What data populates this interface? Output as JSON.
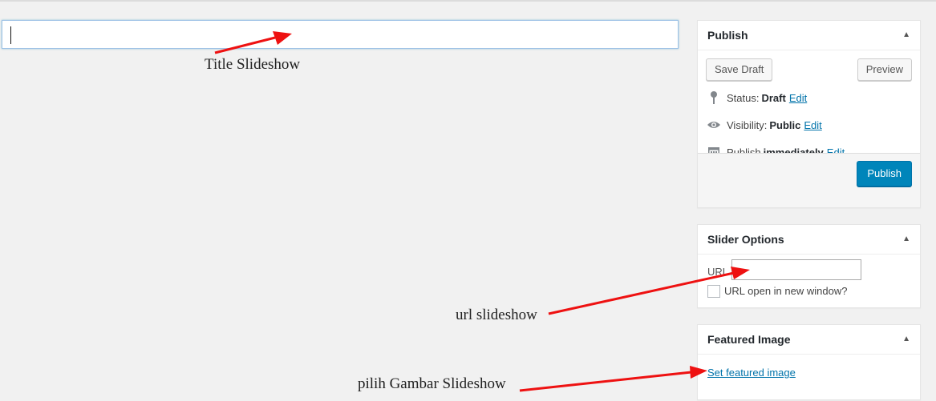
{
  "editor": {
    "title_value": ""
  },
  "annotations": {
    "title": "Title Slideshow",
    "url": "url slideshow",
    "image": "pilih Gambar Slideshow",
    "arrow_color": "#ee1111"
  },
  "publish_box": {
    "heading": "Publish",
    "save_draft_label": "Save Draft",
    "preview_label": "Preview",
    "status_label": "Status:",
    "status_value": "Draft",
    "visibility_label": "Visibility:",
    "visibility_value": "Public",
    "publish_label": "Publish",
    "publish_value": "immediately",
    "edit_label": "Edit",
    "publish_button_label": "Publish",
    "icons": [
      "pin-icon",
      "eye-icon",
      "calendar-icon"
    ]
  },
  "slider_options": {
    "heading": "Slider Options",
    "url_label": "URL",
    "url_value": "",
    "new_window_label": "URL open in new window?",
    "new_window_checked": false
  },
  "featured_image": {
    "heading": "Featured Image",
    "set_link": "Set featured image"
  },
  "colors": {
    "primary": "#0085ba",
    "link": "#0073aa",
    "background": "#f1f1f1"
  }
}
